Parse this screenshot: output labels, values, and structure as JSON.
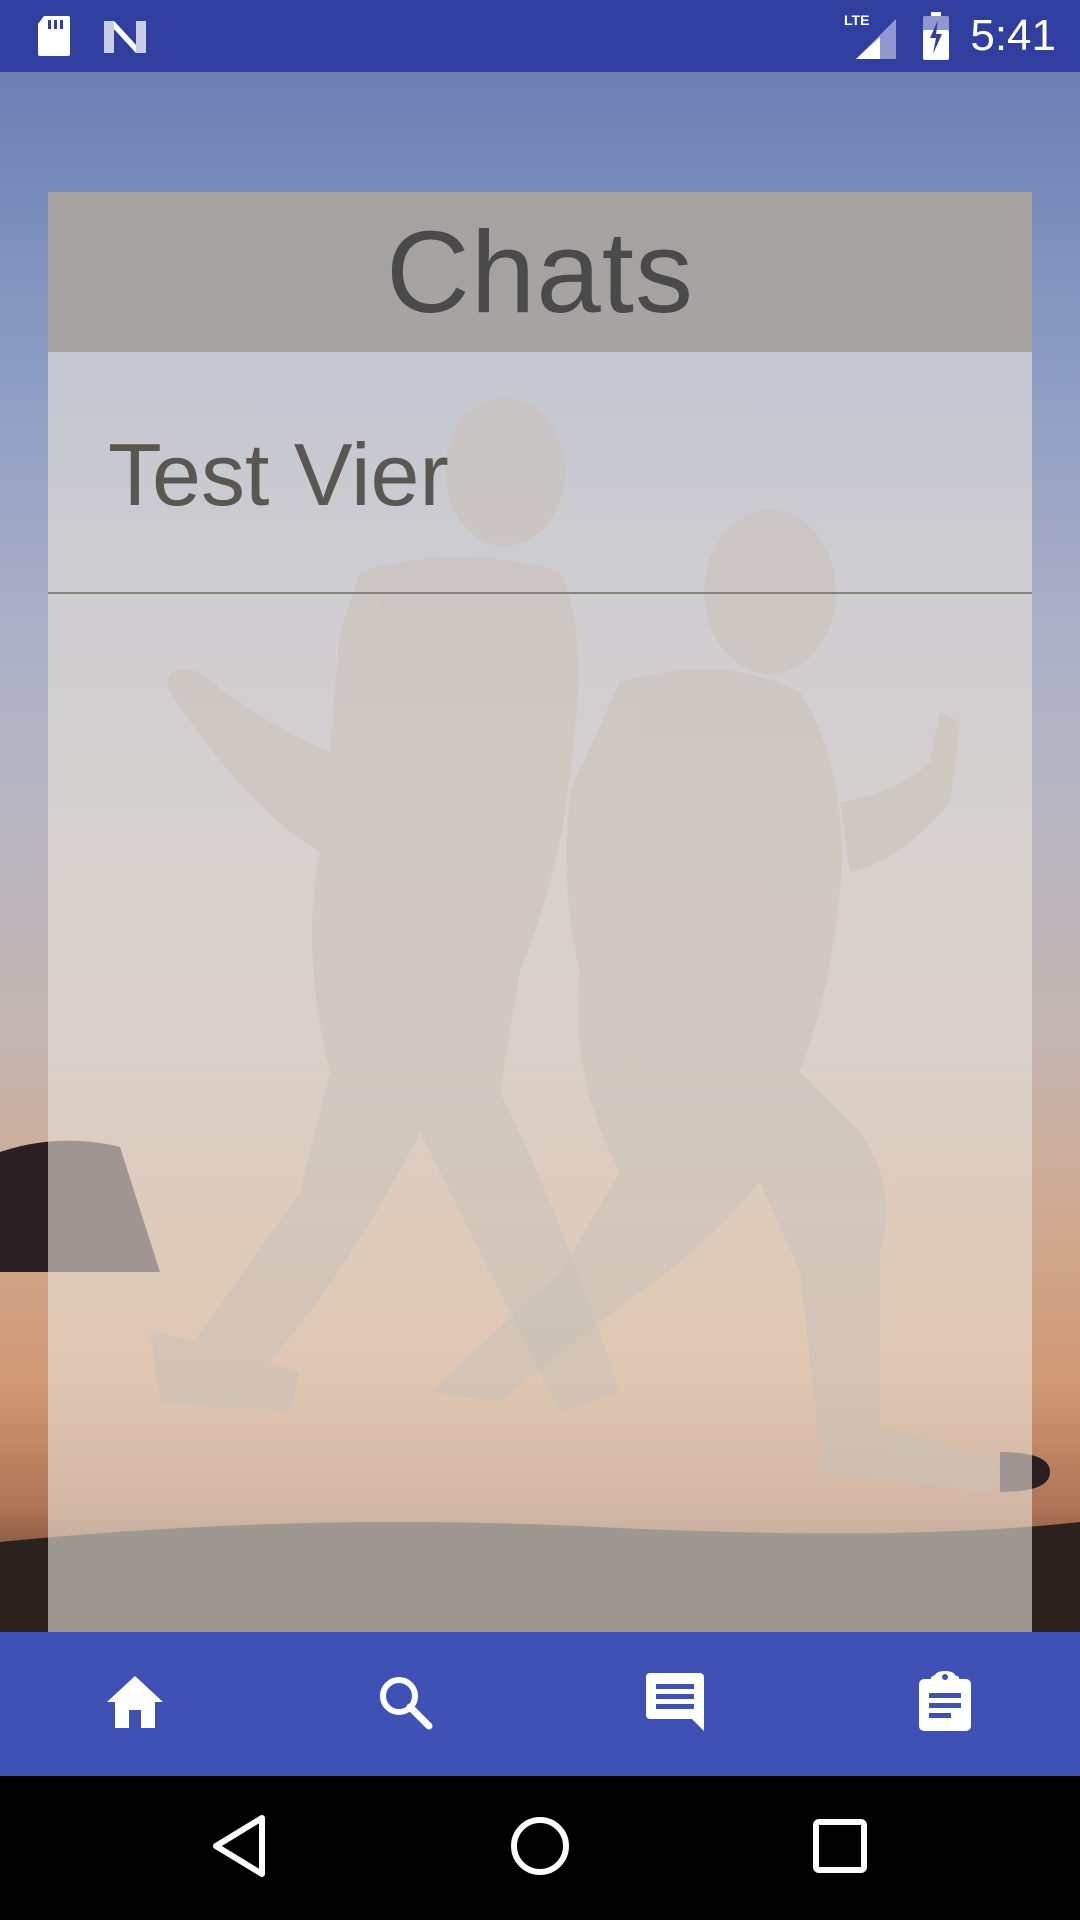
{
  "status_bar": {
    "time": "5:41",
    "network_label": "LTE",
    "icons": [
      "sd-card-icon",
      "n-logo-icon",
      "lte-signal-icon",
      "battery-charging-icon"
    ]
  },
  "chats": {
    "title": "Chats",
    "items": [
      {
        "name": "Test Vier"
      }
    ]
  },
  "bottom_nav": {
    "items": [
      {
        "icon": "home-icon"
      },
      {
        "icon": "search-icon"
      },
      {
        "icon": "chat-icon",
        "selected": true
      },
      {
        "icon": "assignment-icon"
      }
    ]
  },
  "system_nav": {
    "items": [
      "back-icon",
      "home-circle-icon",
      "recents-icon"
    ]
  },
  "colors": {
    "status_bar": "#303f9f",
    "bottom_nav": "#3f51b5",
    "title_text": "#4a4a4a",
    "item_text": "#5a5753"
  }
}
